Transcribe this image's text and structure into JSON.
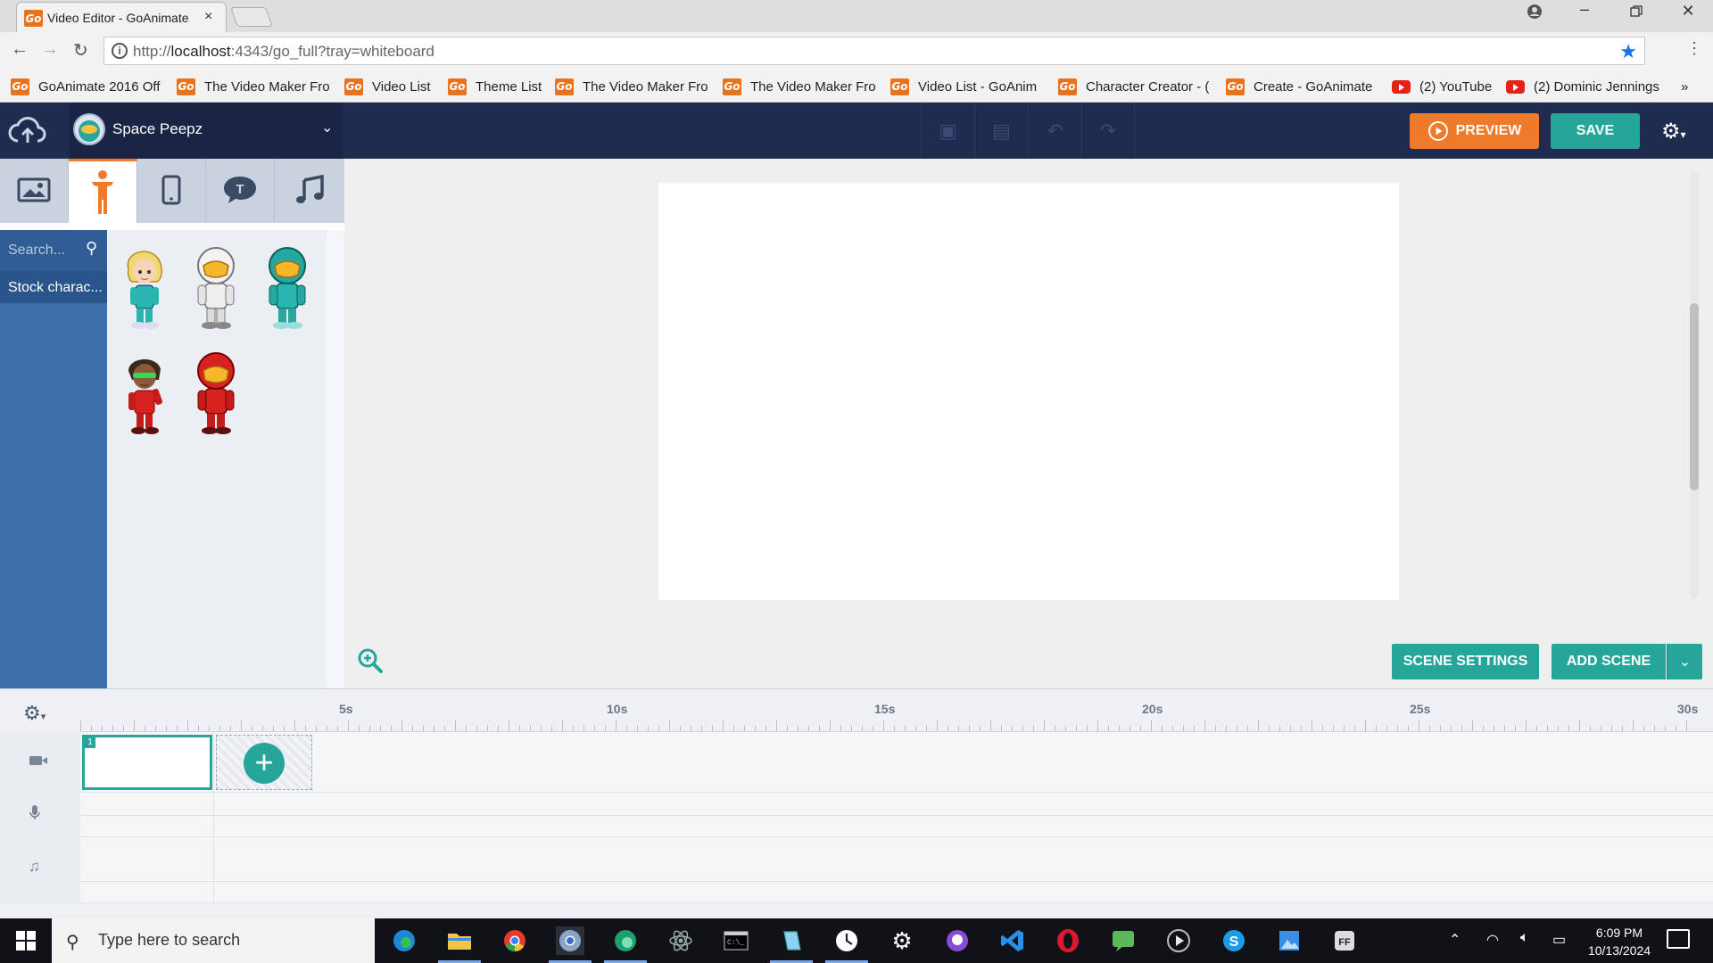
{
  "browser": {
    "tab_title": "Video Editor - GoAnimate",
    "tab_close": "×",
    "url_host": "localhost",
    "url_prefix": "http://",
    "url_rest": ":4343/go_full?tray=whiteboard",
    "bookmarks": [
      {
        "label": "GoAnimate 2016 Off",
        "icon": "goanimate-favicon"
      },
      {
        "label": "The Video Maker Fro",
        "icon": "goanimate-favicon"
      },
      {
        "label": "Video List",
        "icon": "goanimate-favicon"
      },
      {
        "label": "Theme List",
        "icon": "goanimate-favicon"
      },
      {
        "label": "The Video Maker Fro",
        "icon": "goanimate-favicon"
      },
      {
        "label": "The Video Maker Fro",
        "icon": "goanimate-favicon"
      },
      {
        "label": "Video List - GoAnim",
        "icon": "goanimate-favicon"
      },
      {
        "label": "Character Creator - (",
        "icon": "goanimate-favicon"
      },
      {
        "label": "Create - GoAnimate",
        "icon": "goanimate-favicon"
      },
      {
        "label": "(2) YouTube",
        "icon": "youtube-favicon"
      },
      {
        "label": "(2) Dominic Jennings",
        "icon": "youtube-favicon"
      }
    ],
    "more_bookmarks": "»"
  },
  "app": {
    "theme_name": "Space Peepz",
    "preview_label": "PREVIEW",
    "save_label": "SAVE",
    "search_placeholder": "Search...",
    "category": "Stock charac...",
    "scene_settings_label": "SCENE SETTINGS",
    "add_scene_label": "ADD SCENE",
    "colors": {
      "header": "#1f2b4f",
      "accent_orange": "#ef7a2a",
      "accent_teal": "#26a69a",
      "sidebar_blue": "#3c6ea8"
    }
  },
  "left_tabs": [
    "background-tab",
    "characters-tab",
    "props-tab",
    "text-bubble-tab",
    "music-tab"
  ],
  "characters": [
    {
      "name": "blonde-woman-teal-suit"
    },
    {
      "name": "white-armor-soldier"
    },
    {
      "name": "teal-armor-soldier"
    },
    {
      "name": "dreadlock-man-red-suit"
    },
    {
      "name": "red-armor-soldier"
    }
  ],
  "timeline": {
    "labels": [
      "5s",
      "10s",
      "15s",
      "20s",
      "25s",
      "30s"
    ],
    "scene_number": "1"
  },
  "taskbar": {
    "search_text": "Type here to search",
    "time": "6:09 PM",
    "date": "10/13/2024"
  }
}
